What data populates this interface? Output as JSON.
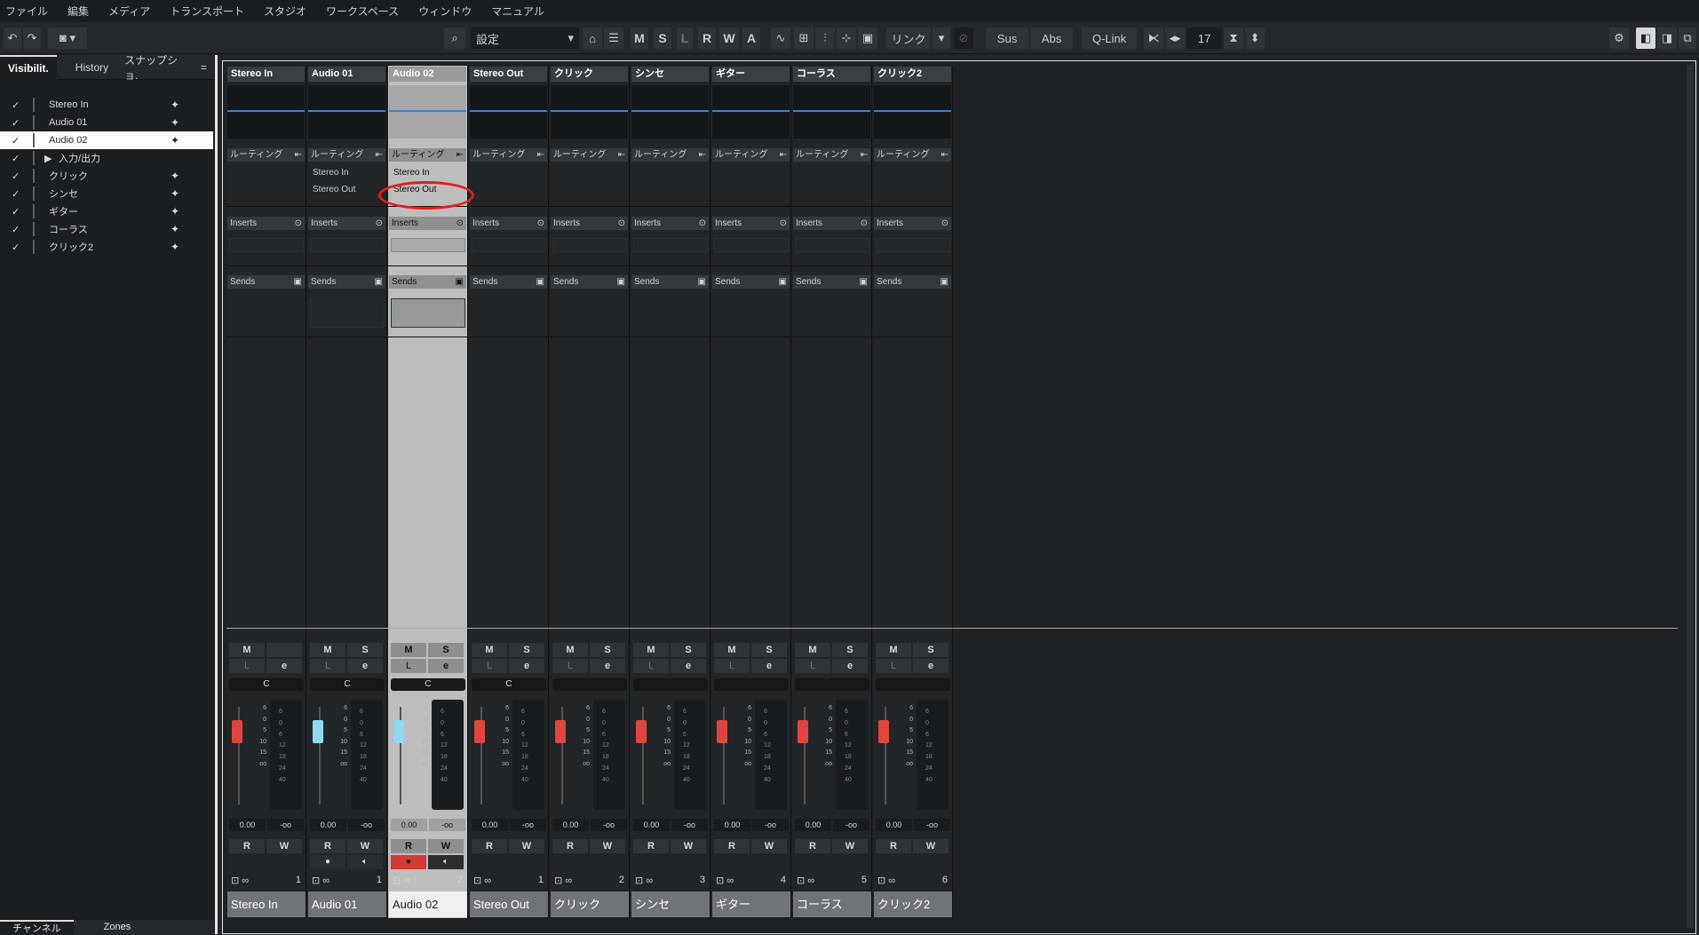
{
  "menu": [
    "ファイル",
    "編集",
    "メディア",
    "トランスポート",
    "スタジオ",
    "ワークスペース",
    "ウィンドウ",
    "マニュアル"
  ],
  "toolbar": {
    "preset": "設定",
    "mode_letters": [
      "M",
      "S",
      "L",
      "R",
      "W",
      "A"
    ],
    "link": "リンク",
    "sus": "Sus",
    "abs": "Abs",
    "qlink": "Q-Link",
    "channel_count": "17"
  },
  "left_panel": {
    "tabs": [
      "Visibilit.",
      "History",
      "スナップショ."
    ],
    "items": [
      {
        "name": "Stereo In",
        "check": "✓",
        "selected": false
      },
      {
        "name": "Audio 01",
        "check": "✓",
        "selected": false
      },
      {
        "name": "Audio 02",
        "check": "✓",
        "selected": true
      },
      {
        "name": "入力/出力",
        "check": "✓",
        "selected": false
      },
      {
        "name": "クリック",
        "check": "✓",
        "selected": false
      },
      {
        "name": "シンセ",
        "check": "✓",
        "selected": false
      },
      {
        "name": "ギター",
        "check": "✓",
        "selected": false
      },
      {
        "name": "コーラス",
        "check": "✓",
        "selected": false
      },
      {
        "name": "クリック2",
        "check": "✓",
        "selected": false
      }
    ],
    "bottom_tabs": [
      "チャンネル",
      "Zones"
    ]
  },
  "mixer": {
    "routing_label": "ルーティング",
    "inserts_label": "Inserts",
    "sends_label": "Sends",
    "routing_in": "Stereo In",
    "routing_out": "Stereo Out",
    "mute": "M",
    "solo": "S",
    "listen": "L",
    "read": "R",
    "write": "W",
    "volume": "0.00",
    "peak": "-oo",
    "fader_scale": [
      "6",
      "0",
      "5",
      "10",
      "15",
      "",
      "",
      "oo"
    ],
    "meter_scale": [
      "6",
      "0",
      "6",
      "12",
      "18",
      "24",
      "",
      "40"
    ],
    "channels": [
      {
        "name": "Stereo In",
        "number": "1",
        "fader": "red",
        "solo": false,
        "routing": false,
        "pan": "C",
        "rec": false
      },
      {
        "name": "Audio 01",
        "number": "1",
        "fader": "blue",
        "solo": true,
        "routing": true,
        "pan": "C",
        "rec": true
      },
      {
        "name": "Audio 02",
        "number": "2",
        "fader": "blue",
        "solo": true,
        "routing": true,
        "pan": "C",
        "rec": true,
        "selected": true
      },
      {
        "name": "Stereo Out",
        "number": "1",
        "fader": "red",
        "solo": true,
        "routing": false,
        "pan": "C",
        "rec": false
      },
      {
        "name": "クリック",
        "number": "2",
        "fader": "red",
        "solo": true,
        "routing": false,
        "pan": "",
        "rec": false
      },
      {
        "name": "シンセ",
        "number": "3",
        "fader": "red",
        "solo": true,
        "routing": false,
        "pan": "",
        "rec": false
      },
      {
        "name": "ギター",
        "number": "4",
        "fader": "red",
        "solo": true,
        "routing": false,
        "pan": "",
        "rec": false
      },
      {
        "name": "コーラス",
        "number": "5",
        "fader": "red",
        "solo": true,
        "routing": false,
        "pan": "",
        "rec": false
      },
      {
        "name": "クリック2",
        "number": "6",
        "fader": "red",
        "solo": true,
        "routing": false,
        "pan": "",
        "rec": false
      }
    ]
  },
  "colors": {
    "accent_line": "#3a83c9",
    "fader_red": "#e0453f",
    "fader_blue": "#8fd7f2",
    "rec_on": "#d43a34",
    "annotation": "#e0201e"
  }
}
